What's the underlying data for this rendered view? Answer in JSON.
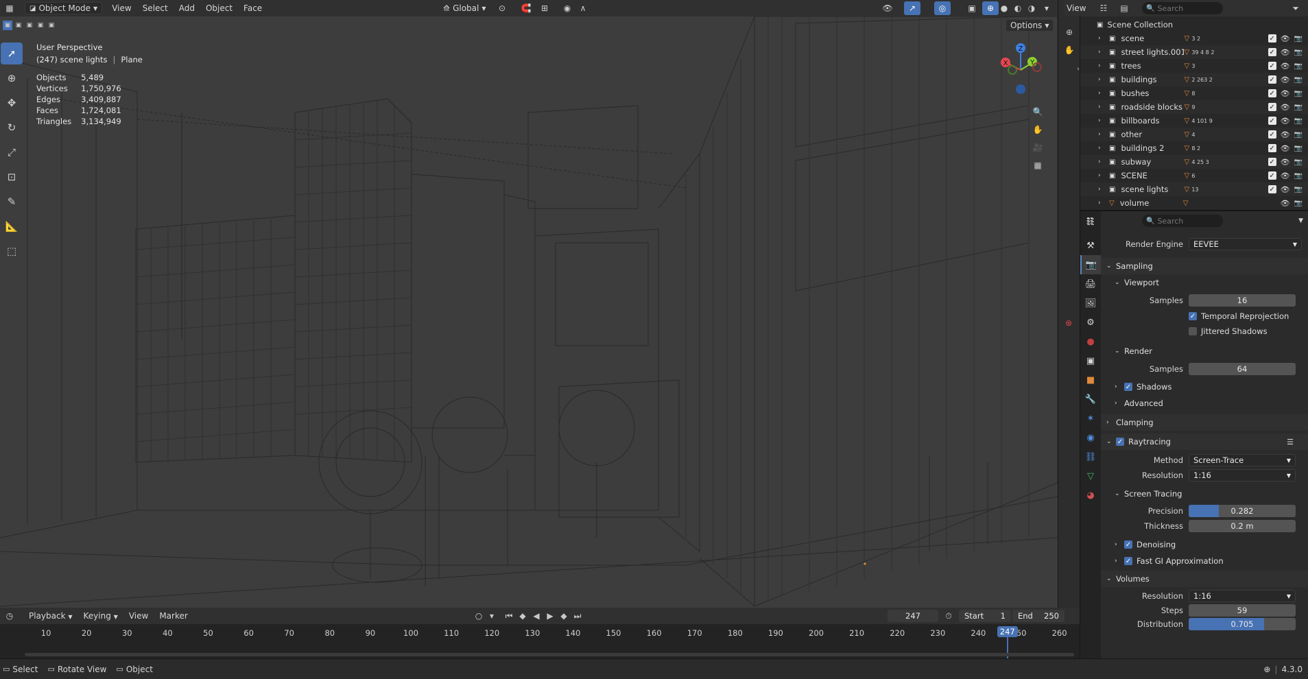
{
  "topbar": {
    "mode": "Object Mode",
    "menus": [
      "View",
      "Select",
      "Add",
      "Object",
      "Face"
    ],
    "transform_orientation": "Global",
    "options_label": "Options"
  },
  "viewport": {
    "perspective": "User Perspective",
    "collection_info": "(247) scene lights",
    "active_object": "Plane",
    "stats": [
      {
        "label": "Objects",
        "value": "5,489"
      },
      {
        "label": "Vertices",
        "value": "1,750,976"
      },
      {
        "label": "Edges",
        "value": "3,409,887"
      },
      {
        "label": "Faces",
        "value": "1,724,081"
      },
      {
        "label": "Triangles",
        "value": "3,134,949"
      }
    ],
    "gizmo": {
      "x": "X",
      "y": "Y",
      "z": "Z"
    }
  },
  "outliner": {
    "view_label": "View",
    "search_placeholder": "Search",
    "root": "Scene Collection",
    "items": [
      {
        "name": "scene",
        "counts": "3 2"
      },
      {
        "name": "street lights.001",
        "counts": "39 4 8 2"
      },
      {
        "name": "trees",
        "counts": "3"
      },
      {
        "name": "buildings",
        "counts": "2 263 2"
      },
      {
        "name": "bushes",
        "counts": "8"
      },
      {
        "name": "roadside blocks",
        "counts": "9"
      },
      {
        "name": "billboards",
        "counts": "4 101 9"
      },
      {
        "name": "other",
        "counts": "4"
      },
      {
        "name": "buildings 2",
        "counts": "8 2"
      },
      {
        "name": "subway",
        "counts": "4 25 3"
      },
      {
        "name": "SCENE",
        "counts": "6"
      },
      {
        "name": "scene lights",
        "counts": "13"
      },
      {
        "name": "volume",
        "counts": ""
      }
    ]
  },
  "properties": {
    "search_placeholder": "Search",
    "render_engine_label": "Render Engine",
    "render_engine": "EEVEE",
    "sampling": "Sampling",
    "viewport": "Viewport",
    "viewport_samples_label": "Samples",
    "viewport_samples": "16",
    "temporal_reprojection": "Temporal Reprojection",
    "jittered_shadows": "Jittered Shadows",
    "render": "Render",
    "render_samples_label": "Samples",
    "render_samples": "64",
    "shadows": "Shadows",
    "advanced": "Advanced",
    "clamping": "Clamping",
    "raytracing": "Raytracing",
    "method_label": "Method",
    "method": "Screen-Trace",
    "resolution_label": "Resolution",
    "resolution": "1:16",
    "screen_tracing": "Screen Tracing",
    "precision_label": "Precision",
    "precision": "0.282",
    "precision_fraction": 0.282,
    "thickness_label": "Thickness",
    "thickness": "0.2 m",
    "denoising": "Denoising",
    "fast_gi": "Fast GI Approximation",
    "volumes": "Volumes",
    "vol_resolution_label": "Resolution",
    "vol_resolution": "1:16",
    "steps_label": "Steps",
    "steps": "59",
    "distribution_label": "Distribution",
    "distribution": "0.705",
    "distribution_fraction": 0.705
  },
  "timeline": {
    "menus": [
      "Playback",
      "Keying",
      "View",
      "Marker"
    ],
    "current_frame": "247",
    "start_label": "Start",
    "start": "1",
    "end_label": "End",
    "end": "250",
    "ticks": [
      "10",
      "20",
      "30",
      "40",
      "50",
      "60",
      "70",
      "80",
      "90",
      "100",
      "110",
      "120",
      "130",
      "140",
      "150",
      "160",
      "170",
      "180",
      "190",
      "200",
      "210",
      "220",
      "230",
      "240",
      "250",
      "260"
    ],
    "playhead": "247"
  },
  "statusbar": {
    "select": "Select",
    "rotate": "Rotate View",
    "object": "Object",
    "version": "4.3.0"
  },
  "colors": {
    "accent": "#4772b3",
    "orange": "#e08a3b",
    "axis_x": "#e8474f",
    "axis_y": "#8bd12f",
    "axis_z": "#3f80e3"
  }
}
